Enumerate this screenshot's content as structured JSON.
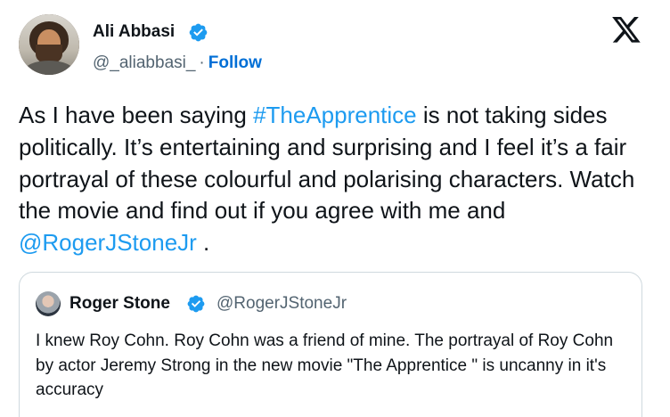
{
  "author": {
    "name": "Ali Abbasi",
    "handle": "@_aliabbasi_",
    "separator": "·",
    "follow_label": "Follow",
    "verified_icon": "verified-badge-icon",
    "avatar_icon": "avatar-ali-abbasi"
  },
  "platform_logo": "x-logo-icon",
  "tweet": {
    "text_before_hashtag": "As I have been saying ",
    "hashtag": "#TheApprentice",
    "text_middle": " is not taking sides politically. It’s entertaining and surprising and I feel it’s a fair portrayal of these colourful and polarising characters. Watch the movie and find out if you agree with me and  ",
    "mention": "@RogerJStoneJr",
    "text_after_mention": " ."
  },
  "quoted_tweet": {
    "name": "Roger Stone",
    "handle": "@RogerJStoneJr",
    "verified_icon": "verified-badge-icon",
    "text": "I knew Roy Cohn. Roy Cohn was a friend of mine. The portrayal of Roy Cohn by actor Jeremy Strong in the new movie \"The Apprentice \" is uncanny in it's accuracy"
  },
  "colors": {
    "accent": "#1d9bf0",
    "follow": "#006fd6",
    "text": "#0f1419",
    "muted": "#536471",
    "border": "#cfd9de"
  }
}
